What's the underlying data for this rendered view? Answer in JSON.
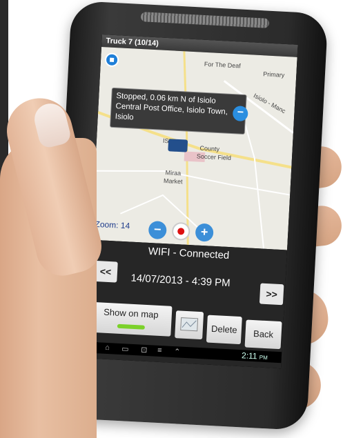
{
  "screen": {
    "title": "Truck 7 (10/14)",
    "map": {
      "labels": {
        "deaf": "For The Deaf",
        "primary": "Primary",
        "isiolo_manc": "Isiolo - Manc",
        "county": "County",
        "soccer": "Soccer Field",
        "miraa": "Miraa",
        "market": "Market",
        "isi": "ISI"
      },
      "popup_text": "Stopped, 0.06 km N of Isiolo Central Post Office, Isiolo Town, Isiolo",
      "zoom_text": "Zoom: 14"
    },
    "status_text": "WIFI - Connected",
    "prev_label": "<<",
    "next_label": ">>",
    "datetime": "14/07/2013 - 4:39 PM",
    "buttons": {
      "show_on_map": "Show on map",
      "delete": "Delete",
      "back": "Back"
    },
    "system_time": "2:11",
    "system_ampm": "PM"
  },
  "colors": {
    "accent_blue": "#2a8ee0",
    "indicator_green": "#7bd12a",
    "record_red": "#dd1111"
  }
}
